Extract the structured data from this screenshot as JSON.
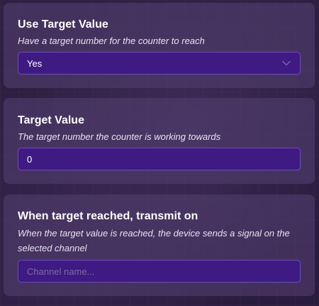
{
  "use_target_value": {
    "title": "Use Target Value",
    "description": "Have a target number for the counter to reach",
    "selected": "Yes",
    "icon": "chevron-down-icon"
  },
  "target_value": {
    "title": "Target Value",
    "description": "The target number the counter is working towards",
    "value": "0"
  },
  "transmit": {
    "title": "When target reached, transmit on",
    "description": "When the target value is reached, the device sends a signal on the selected channel",
    "placeholder": "Channel name..."
  },
  "colors": {
    "panel": "#503e6e",
    "input_bg": "#3e1a82",
    "input_border": "#6b4fb8",
    "placeholder": "#7f6aa8"
  }
}
